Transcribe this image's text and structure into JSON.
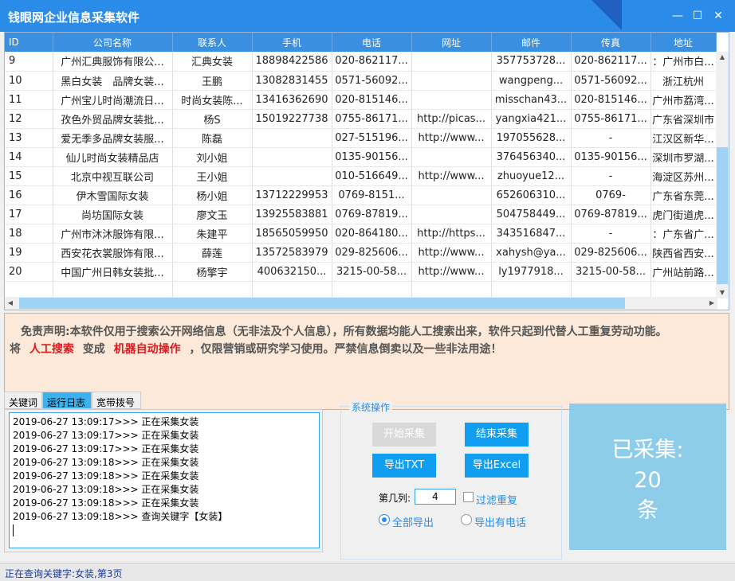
{
  "window": {
    "title": "钱眼网企业信息采集软件",
    "minimize": "—",
    "maximize": "☐",
    "close": "✕"
  },
  "grid": {
    "columns": [
      "ID",
      "公司名称",
      "联系人",
      "手机",
      "电话",
      "网址",
      "邮件",
      "传真",
      "地址"
    ],
    "rows": [
      [
        "9",
        "广州汇典服饰有限公...",
        "汇典女装",
        "18898422586",
        "020-862117...",
        "",
        "357753728...",
        "020-862117...",
        "：广州市白..."
      ],
      [
        "10",
        "黑白女装　品牌女装...",
        "王鹏",
        "13082831455",
        "0571-56092...",
        "",
        "wangpeng...",
        "0571-56092...",
        "浙江杭州"
      ],
      [
        "11",
        "广州宝儿时尚潮流日...",
        "时尚女装陈...",
        "13416362690",
        "020-815146...",
        "",
        "misschan43...",
        "020-815146...",
        "广州市荔湾..."
      ],
      [
        "12",
        "孜色外贸品牌女装批...",
        "杨S",
        "15019227738",
        "0755-86171...",
        "http://picas...",
        "yangxia421...",
        "0755-86171...",
        "广东省深圳市"
      ],
      [
        "13",
        "爱无季多品牌女装服...",
        "陈磊",
        "",
        "027-515196...",
        "http://www...",
        "197055628...",
        "-",
        "江汉区新华..."
      ],
      [
        "14",
        "仙儿时尚女装精品店",
        "刘小姐",
        "",
        "0135-90156...",
        "",
        "376456340...",
        "0135-90156...",
        "深圳市罗湖..."
      ],
      [
        "15",
        "北京中视互联公司",
        "王小姐",
        "",
        "010-516649...",
        "http://www...",
        "zhuoyue12...",
        "-",
        "海淀区苏州..."
      ],
      [
        "16",
        "伊木雪国际女装",
        "杨小姐",
        "13712229953",
        "0769-8151...",
        "",
        "652606310...",
        "0769-",
        "广东省东莞..."
      ],
      [
        "17",
        "尚坊国际女装",
        "廖文玉",
        "13925583881",
        "0769-87819...",
        "",
        "504758449...",
        "0769-87819...",
        "虎门街道虎..."
      ],
      [
        "18",
        "广州市沐沐服饰有限...",
        "朱建平",
        "18565059950",
        "020-864180...",
        "http://https...",
        "343516847...",
        "-",
        "：广东省广..."
      ],
      [
        "19",
        "西安花衣裳服饰有限...",
        "薛莲",
        "13572583979",
        "029-825606...",
        "http://www...",
        "xahysh@ya...",
        "029-825606...",
        "陕西省西安..."
      ],
      [
        "20",
        "中国广州日韩女装批...",
        "杨擎宇",
        "400632150...",
        "3215-00-58...",
        "http://www...",
        "ly1977918...",
        "3215-00-58...",
        "广州站前路..."
      ]
    ]
  },
  "disclaimer": {
    "line1": "免责声明:本软件仅用于搜索公开网络信息（无非法及个人信息），所有数据均能人工搜索出来，软件只起到代替人工重复劳动功能。",
    "line2_a": "将",
    "line2_red1": "人工搜索",
    "line2_b": "变成",
    "line2_red2": "机器自动操作",
    "line2_c": "，仅限营销或研究学习使用。严禁信息倒卖以及一些非法用途！"
  },
  "tabs": [
    "关键词",
    "运行日志",
    "宽带拨号"
  ],
  "log": [
    "2019-06-27 13:09:17>>> 正在采集女装",
    "2019-06-27 13:09:17>>> 正在采集女装",
    "2019-06-27 13:09:17>>> 正在采集女装",
    "2019-06-27 13:09:18>>> 正在采集女装",
    "2019-06-27 13:09:18>>> 正在采集女装",
    "2019-06-27 13:09:18>>> 正在采集女装",
    "2019-06-27 13:09:18>>> 正在采集女装",
    "2019-06-27 13:09:18>>> 查询关键字【女装】"
  ],
  "ops": {
    "legend": "系统操作",
    "start": "开始采集",
    "stop": "结束采集",
    "export_txt": "导出TXT",
    "export_excel": "导出Excel",
    "column_label": "第几列:",
    "column_value": "4",
    "filter_dup": "过滤重复",
    "export_all": "全部导出",
    "export_phone": "导出有电话"
  },
  "counter": {
    "label": "已采集:",
    "count": "20",
    "unit": "条"
  },
  "status": "正在查询关键字:女装,第3页",
  "colors": {
    "accent": "#2a8ce8",
    "button": "#0f9ef0",
    "red": "#e0191e"
  }
}
